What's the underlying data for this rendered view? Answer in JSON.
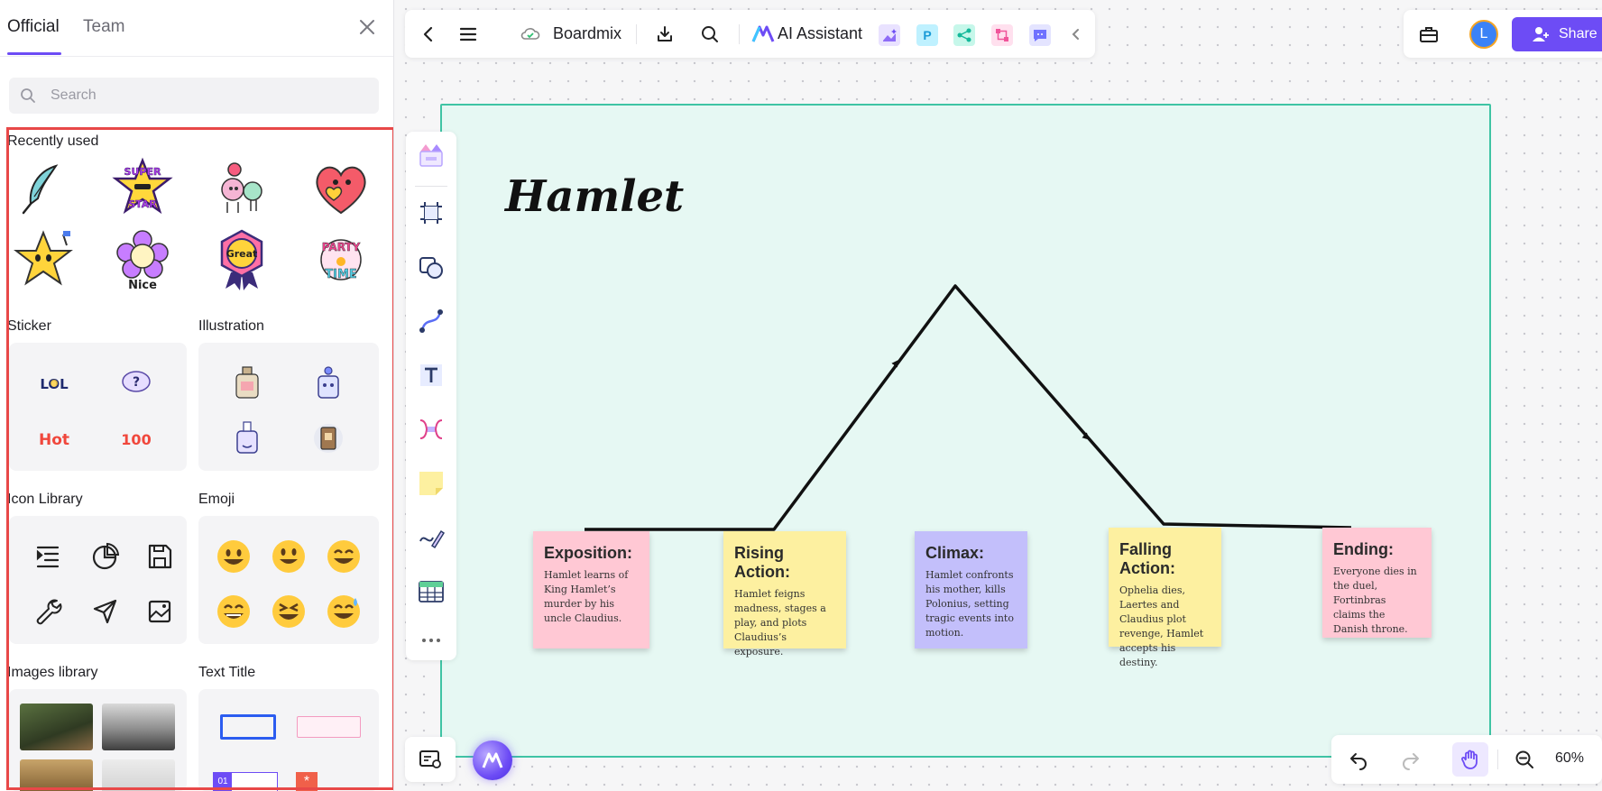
{
  "panel": {
    "tabs": [
      "Official",
      "Team"
    ],
    "search_placeholder": "Search",
    "sections": {
      "recent": "Recently used",
      "sticker": "Sticker",
      "illustration": "Illustration",
      "icon_library": "Icon Library",
      "emoji": "Emoji",
      "images": "Images library",
      "text_title": "Text Title"
    },
    "stickers": {
      "super": "SUPER STAR",
      "great": "Great",
      "nice": "Nice",
      "party": "PARTY TIME",
      "lol": "LOL",
      "hot": "Hot",
      "hundred": "100",
      "question": "?",
      "text_tag": "01"
    }
  },
  "toolbar": {
    "app_name": "Boardmix",
    "ai_label": "AI Assistant",
    "mini_apps": [
      "P"
    ],
    "share_label": "Share",
    "avatar_initial": "L"
  },
  "canvas": {
    "title": "Hamlet",
    "notes": [
      {
        "heading": "Exposition:",
        "body": "Hamlet learns of King Hamlet’s murder by his uncle Claudius.",
        "color": "#ffc8d4"
      },
      {
        "heading": "Rising Action:",
        "body": "Hamlet feigns madness, stages a play, and plots Claudius’s exposure.",
        "color": "#fdf0a0"
      },
      {
        "heading": "Climax:",
        "body": "Hamlet confronts his mother, kills Polonius, setting tragic events into motion.",
        "color": "#c3bffb"
      },
      {
        "heading": "Falling Action:",
        "body": "Ophelia dies, Laertes and Claudius plot revenge, Hamlet accepts his destiny.",
        "color": "#fdf0a0"
      },
      {
        "heading": "Ending:",
        "body": "Everyone dies in the duel, Fortinbras claims the Danish throne.",
        "color": "#ffc8d4"
      }
    ]
  },
  "zoom": "60%",
  "colors": {
    "accent": "#6d4cf5",
    "frame": "#3fc4a4",
    "highlight": "#e84848"
  }
}
